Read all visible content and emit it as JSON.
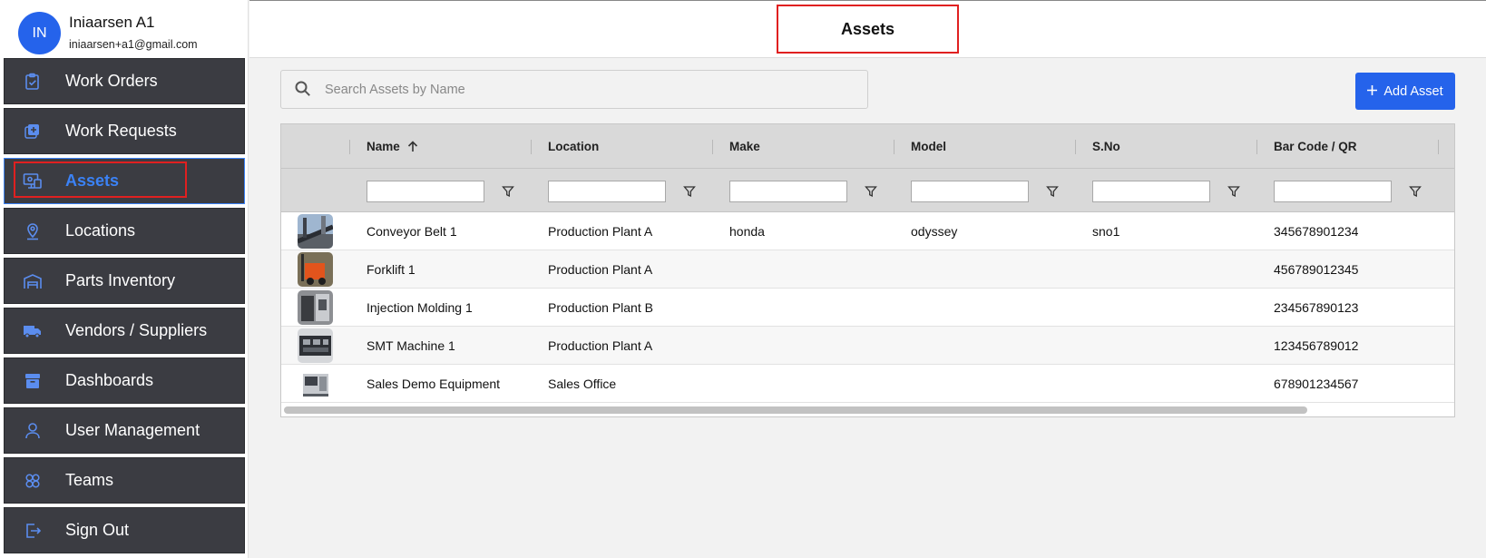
{
  "user": {
    "initials": "IN",
    "name": "Iniaarsen A1",
    "email": "iniaarsen+a1@gmail.com"
  },
  "nav": [
    {
      "label": "Work Orders",
      "icon": "clipboard-check-icon"
    },
    {
      "label": "Work Requests",
      "icon": "add-request-icon"
    },
    {
      "label": "Assets",
      "icon": "asset-monitor-icon",
      "active": true
    },
    {
      "label": "Locations",
      "icon": "location-pin-icon"
    },
    {
      "label": "Parts Inventory",
      "icon": "warehouse-icon"
    },
    {
      "label": "Vendors / Suppliers",
      "icon": "truck-icon"
    },
    {
      "label": "Dashboards",
      "icon": "archive-box-icon"
    },
    {
      "label": "User Management",
      "icon": "user-icon"
    },
    {
      "label": "Teams",
      "icon": "teams-icon"
    },
    {
      "label": "Sign Out",
      "icon": "sign-out-icon"
    }
  ],
  "header": {
    "title": "Assets"
  },
  "search": {
    "placeholder": "Search Assets by Name",
    "value": ""
  },
  "add_button": {
    "label": "Add Asset",
    "icon": "plus-icon"
  },
  "table": {
    "columns": [
      "Name",
      "Location",
      "Make",
      "Model",
      "S.No",
      "Bar Code / QR"
    ],
    "sort": {
      "column": "Name",
      "direction": "ascending",
      "icon": "arrow-up-icon"
    },
    "rows": [
      {
        "name": "Conveyor Belt 1",
        "location": "Production Plant A",
        "make": "honda",
        "model": "odyssey",
        "sno": "sno1",
        "barcode": "345678901234"
      },
      {
        "name": "Forklift 1",
        "location": "Production Plant A",
        "make": "",
        "model": "",
        "sno": "",
        "barcode": "456789012345"
      },
      {
        "name": "Injection Molding 1",
        "location": "Production Plant B",
        "make": "",
        "model": "",
        "sno": "",
        "barcode": "234567890123"
      },
      {
        "name": "SMT Machine 1",
        "location": "Production Plant A",
        "make": "",
        "model": "",
        "sno": "",
        "barcode": "123456789012"
      },
      {
        "name": "Sales Demo Equipment",
        "location": "Sales Office",
        "make": "",
        "model": "",
        "sno": "",
        "barcode": "678901234567"
      }
    ]
  },
  "colors": {
    "accent": "#2563eb",
    "nav_bg": "#3b3c42",
    "active": "#3b82f6",
    "highlight": "#e02020"
  }
}
